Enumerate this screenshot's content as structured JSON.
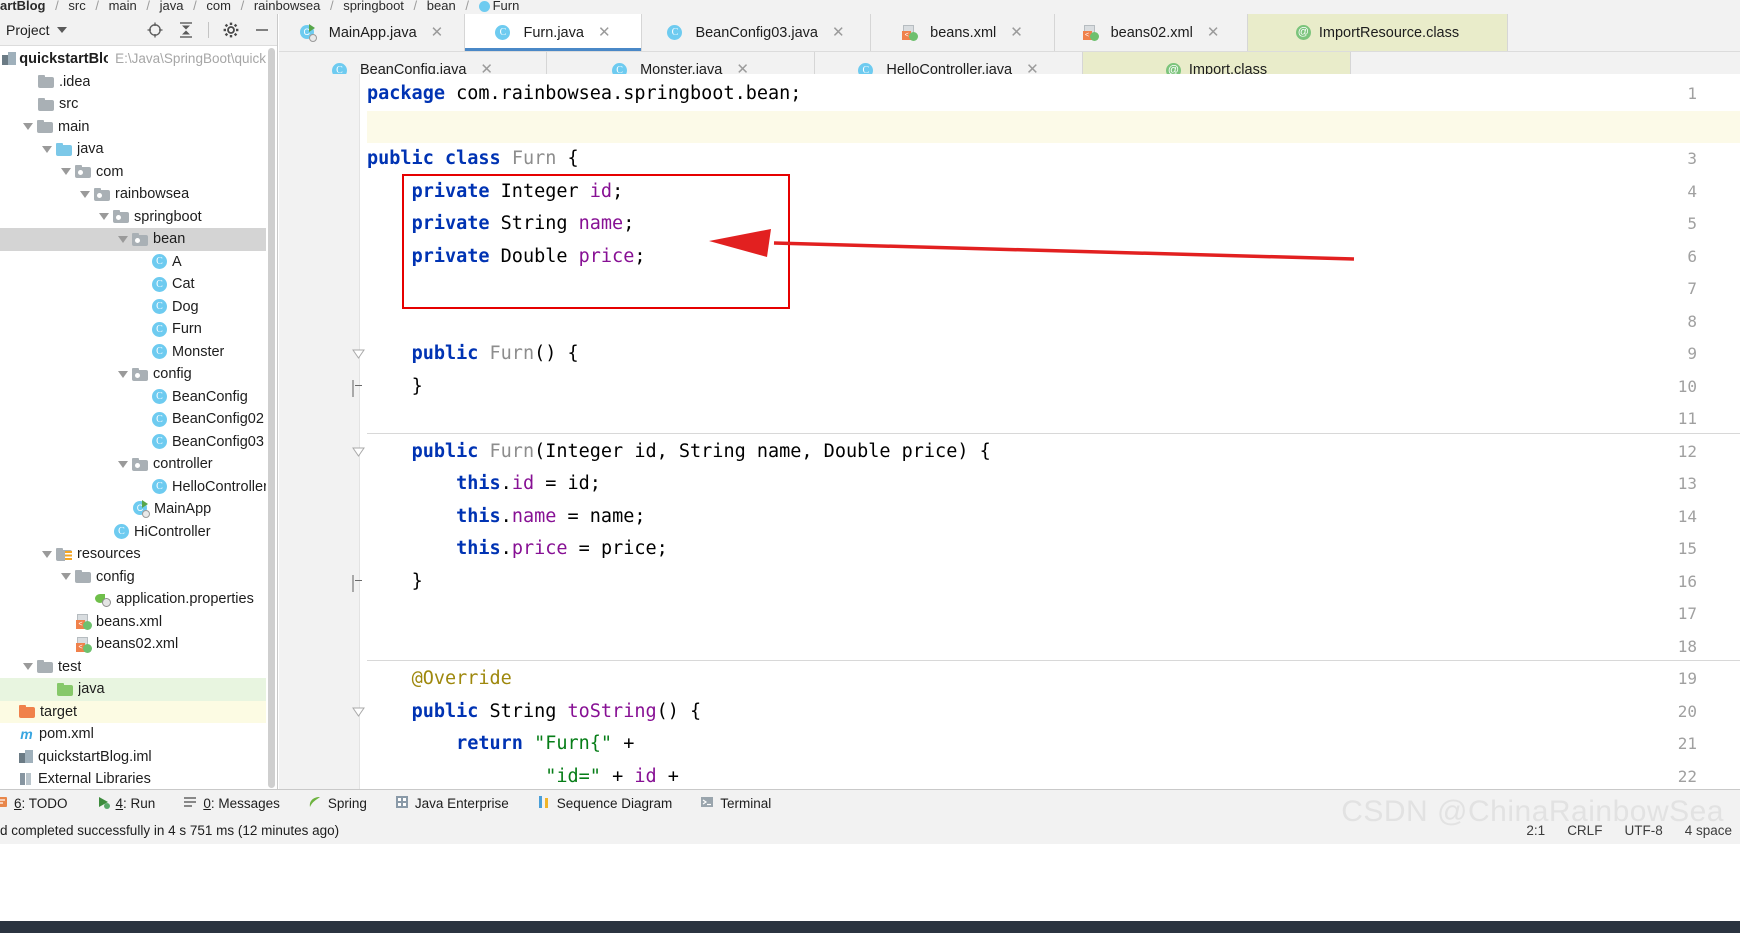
{
  "breadcrumb": {
    "items": [
      "artBlog",
      "src",
      "main",
      "java",
      "com",
      "rainbowsea",
      "springboot",
      "bean",
      "Furn"
    ],
    "separator": "/"
  },
  "project_panel": {
    "title": "Project",
    "toolbar_icons": [
      "locate-icon",
      "collapse-all-icon",
      "settings-gear-icon",
      "hide-icon"
    ],
    "root": {
      "label": "quickstartBlog",
      "path": "E:\\Java\\SpringBoot\\quick"
    },
    "tree": [
      {
        "label": ".idea",
        "indent": 1,
        "icon": "folder-icon",
        "arrow": "none"
      },
      {
        "label": "src",
        "indent": 1,
        "icon": "folder-icon",
        "arrow": "none"
      },
      {
        "label": "main",
        "indent": 1,
        "icon": "folder-icon",
        "arrow": "down"
      },
      {
        "label": "java",
        "indent": 2,
        "icon": "folder-source-icon",
        "arrow": "down"
      },
      {
        "label": "com",
        "indent": 3,
        "icon": "package-icon",
        "arrow": "down"
      },
      {
        "label": "rainbowsea",
        "indent": 4,
        "icon": "package-icon",
        "arrow": "down"
      },
      {
        "label": "springboot",
        "indent": 5,
        "icon": "package-icon",
        "arrow": "down"
      },
      {
        "label": "bean",
        "indent": 6,
        "icon": "package-icon",
        "arrow": "down",
        "selected": "gray"
      },
      {
        "label": "A",
        "indent": 7,
        "icon": "java-class-icon",
        "arrow": "none"
      },
      {
        "label": "Cat",
        "indent": 7,
        "icon": "java-class-icon",
        "arrow": "none"
      },
      {
        "label": "Dog",
        "indent": 7,
        "icon": "java-class-icon",
        "arrow": "none"
      },
      {
        "label": "Furn",
        "indent": 7,
        "icon": "java-class-icon",
        "arrow": "none"
      },
      {
        "label": "Monster",
        "indent": 7,
        "icon": "java-class-icon",
        "arrow": "none"
      },
      {
        "label": "config",
        "indent": 6,
        "icon": "package-icon",
        "arrow": "down"
      },
      {
        "label": "BeanConfig",
        "indent": 7,
        "icon": "java-class-icon",
        "arrow": "none"
      },
      {
        "label": "BeanConfig02",
        "indent": 7,
        "icon": "java-class-icon",
        "arrow": "none"
      },
      {
        "label": "BeanConfig03",
        "indent": 7,
        "icon": "java-class-icon",
        "arrow": "none"
      },
      {
        "label": "controller",
        "indent": 6,
        "icon": "package-icon",
        "arrow": "down"
      },
      {
        "label": "HelloController",
        "indent": 7,
        "icon": "java-class-icon",
        "arrow": "none"
      },
      {
        "label": "MainApp",
        "indent": 6,
        "icon": "spring-main-icon",
        "arrow": "none"
      },
      {
        "label": "HiController",
        "indent": 5,
        "icon": "java-class-icon",
        "arrow": "none"
      },
      {
        "label": "resources",
        "indent": 2,
        "icon": "folder-resource-icon",
        "arrow": "down"
      },
      {
        "label": "config",
        "indent": 3,
        "icon": "folder-icon",
        "arrow": "down"
      },
      {
        "label": "application.properties",
        "indent": 4,
        "icon": "properties-icon",
        "arrow": "none"
      },
      {
        "label": "beans.xml",
        "indent": 3,
        "icon": "xml-file-icon",
        "arrow": "none"
      },
      {
        "label": "beans02.xml",
        "indent": 3,
        "icon": "xml-file-icon",
        "arrow": "none"
      },
      {
        "label": "test",
        "indent": 1,
        "icon": "folder-icon",
        "arrow": "down"
      },
      {
        "label": "java",
        "indent": 2,
        "icon": "folder-test-icon",
        "arrow": "none",
        "selected": "green"
      },
      {
        "label": "target",
        "indent": 0,
        "icon": "folder-excluded-icon",
        "arrow": "none",
        "selected": "yellow"
      },
      {
        "label": "pom.xml",
        "indent": 0,
        "icon": "maven-icon",
        "arrow": "none"
      },
      {
        "label": "quickstartBlog.iml",
        "indent": 0,
        "icon": "module-icon",
        "arrow": "none"
      },
      {
        "label": "External Libraries",
        "indent": 0,
        "icon": "external-libraries-icon",
        "arrow": "none"
      }
    ]
  },
  "editor_tabs": {
    "row1": [
      {
        "label": "MainApp.java",
        "icon": "spring-main-icon",
        "closable": true,
        "state": "normal"
      },
      {
        "label": "Furn.java",
        "icon": "java-class-icon",
        "closable": true,
        "state": "active"
      },
      {
        "label": "BeanConfig03.java",
        "icon": "java-class-icon",
        "closable": true,
        "state": "normal"
      },
      {
        "label": "beans.xml",
        "icon": "xml-file-icon",
        "closable": true,
        "state": "normal"
      },
      {
        "label": "beans02.xml",
        "icon": "xml-file-icon",
        "closable": true,
        "state": "normal"
      },
      {
        "label": "ImportResource.class",
        "icon": "annotation-icon",
        "closable": false,
        "state": "olive"
      }
    ],
    "row2": [
      {
        "label": "BeanConfig.java",
        "icon": "java-class-icon",
        "closable": true,
        "state": "normal"
      },
      {
        "label": "Monster.java",
        "icon": "java-class-icon",
        "closable": true,
        "state": "normal"
      },
      {
        "label": "HelloController.java",
        "icon": "java-class-icon",
        "closable": true,
        "state": "normal"
      },
      {
        "label": "Import.class",
        "icon": "annotation-icon",
        "closable": false,
        "state": "olive"
      }
    ]
  },
  "code": {
    "line_numbers": [
      1,
      2,
      3,
      4,
      5,
      6,
      7,
      8,
      9,
      10,
      11,
      12,
      13,
      14,
      15,
      16,
      17,
      18,
      19,
      20,
      21,
      22
    ],
    "lines": [
      {
        "n": 1,
        "text": "package com.rainbowsea.springboot.bean;"
      },
      {
        "n": 2,
        "text": ""
      },
      {
        "n": 3,
        "text": "public class Furn {"
      },
      {
        "n": 4,
        "text": "    private Integer id;"
      },
      {
        "n": 5,
        "text": "    private String name;"
      },
      {
        "n": 6,
        "text": "    private Double price;"
      },
      {
        "n": 7,
        "text": ""
      },
      {
        "n": 8,
        "text": ""
      },
      {
        "n": 9,
        "text": "    public Furn() {"
      },
      {
        "n": 10,
        "text": "    }"
      },
      {
        "n": 11,
        "text": ""
      },
      {
        "n": 12,
        "text": "    public Furn(Integer id, String name, Double price) {"
      },
      {
        "n": 13,
        "text": "        this.id = id;"
      },
      {
        "n": 14,
        "text": "        this.name = name;"
      },
      {
        "n": 15,
        "text": "        this.price = price;"
      },
      {
        "n": 16,
        "text": "    }"
      },
      {
        "n": 17,
        "text": ""
      },
      {
        "n": 18,
        "text": ""
      },
      {
        "n": 19,
        "text": "    @Override"
      },
      {
        "n": 20,
        "text": "    public String toString() {"
      },
      {
        "n": 21,
        "text": "        return \"Furn{\" +"
      },
      {
        "n": 22,
        "text": "                \"id=\" + id +"
      }
    ],
    "annotation": {
      "highlight_box": "red-rectangle-around-fields",
      "arrow": "red-arrow-pointing-left"
    }
  },
  "tool_window_bar": {
    "items": [
      {
        "label": "6: TODO",
        "icon": "todo-icon"
      },
      {
        "label": "4: Run",
        "icon": "run-icon"
      },
      {
        "label": "0: Messages",
        "icon": "messages-icon"
      },
      {
        "label": "Spring",
        "icon": "spring-leaf-icon"
      },
      {
        "label": "Java Enterprise",
        "icon": "java-enterprise-icon"
      },
      {
        "label": "Sequence Diagram",
        "icon": "sequence-diagram-icon"
      },
      {
        "label": "Terminal",
        "icon": "terminal-icon"
      }
    ]
  },
  "status_bar": {
    "message": "d completed successfully in 4 s 751 ms (12 minutes ago)",
    "caret": "2:1",
    "line_separator": "CRLF",
    "encoding": "UTF-8",
    "indent": "4 space",
    "watermark": "CSDN @ChinaRainbowSea"
  },
  "colors": {
    "accent_blue": "#4a88c7",
    "annotation_red": "#e60000",
    "keyword_blue": "#0033b3",
    "field_purple": "#871094",
    "string_green": "#067d17",
    "annotation_gold": "#9e880d",
    "class_gray": "#8d8d8d",
    "tab_olive": "#e9ecca",
    "selection_gray": "#d4d4d4",
    "selection_green": "#e8f5e0",
    "selection_yellow": "#fcfbe3"
  }
}
